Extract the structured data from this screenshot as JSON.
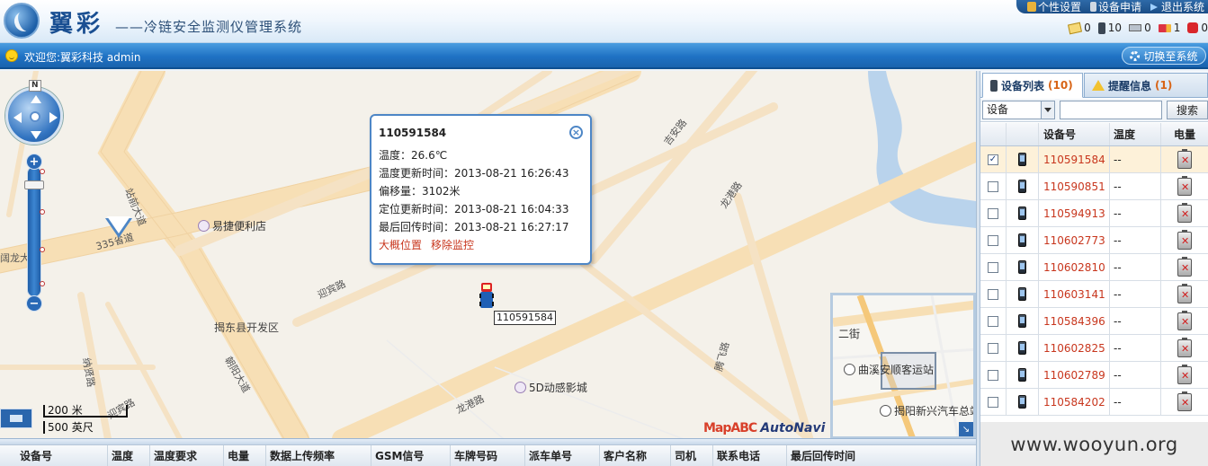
{
  "header": {
    "brand": "翼彩",
    "system_title": "——冷链安全监测仪管理系统",
    "top_links": [
      {
        "label": "个性设置",
        "icon": "user-settings-icon"
      },
      {
        "label": "设备申请",
        "icon": "device-apply-icon"
      },
      {
        "label": "退出系统",
        "icon": "logout-arrow-icon"
      }
    ],
    "counters": [
      {
        "value": "0",
        "icon": "message-envelope-icon"
      },
      {
        "value": "10",
        "icon": "device-phone-icon"
      },
      {
        "value": "0",
        "icon": "device-offline-icon"
      },
      {
        "value": "1",
        "icon": "truck-icon"
      },
      {
        "value": "0",
        "icon": "alarm-bell-icon"
      }
    ]
  },
  "welcome": {
    "text": "欢迎您:翼彩科技 admin",
    "switch_label": "切换至系统"
  },
  "map": {
    "compass_label": "N",
    "road_labels": {
      "zhanqian": "站前大道",
      "shengdao": "335省道",
      "yingbin1": "迎宾路",
      "yingbin2": "迎宾路",
      "jian": "吉安路",
      "longgang1": "龙港路",
      "longgang2": "龙港路",
      "chaoyang": "朝阳大道",
      "naxian": "纳贤路",
      "longda": "阔龙大",
      "tengfei": "腾飞路",
      "kaifaqu": "揭东县开发区"
    },
    "pois": {
      "store": "易捷便利店",
      "cinema": "5D动感影城"
    },
    "vehicle_label": "110591584",
    "scale_metric": "200 米",
    "scale_imperial": "500 英尺",
    "attribution_mapabc": "MapABC",
    "attribution_autonavi": "AutoNavi",
    "overview": {
      "label_erjie": "二街",
      "label_station1": "曲溪安顺客运站",
      "label_station2": "揭阳新兴汽车总站"
    }
  },
  "popup": {
    "title": "110591584",
    "lines": [
      "温度：26.6℃",
      "温度更新时间：2013-08-21 16:26:43",
      "偏移量：3102米",
      "定位更新时间：2013-08-21 16:04:33",
      "最后回传时间：2013-08-21 16:27:17"
    ],
    "link_approx": "大概位置",
    "link_remove": "移除监控",
    "close_symbol": "×"
  },
  "bottom_table": {
    "columns": [
      "设备号",
      "温度",
      "温度要求",
      "电量",
      "数据上传频率",
      "GSM信号",
      "车牌号码",
      "派车单号",
      "客户名称",
      "司机",
      "联系电话",
      "最后回传时间"
    ]
  },
  "side": {
    "tabs": {
      "devices_label": "设备列表",
      "devices_count": "(10)",
      "alerts_label": "提醒信息",
      "alerts_count": "(1)"
    },
    "search": {
      "type_value": "设备",
      "input_value": "",
      "button_label": "搜索"
    },
    "table": {
      "headers": [
        "设备号",
        "温度",
        "电量"
      ],
      "rows": [
        {
          "id": "110591584",
          "temp": "--",
          "checked": true
        },
        {
          "id": "110590851",
          "temp": "--",
          "checked": false
        },
        {
          "id": "110594913",
          "temp": "--",
          "checked": false
        },
        {
          "id": "110602773",
          "temp": "--",
          "checked": false
        },
        {
          "id": "110602810",
          "temp": "--",
          "checked": false
        },
        {
          "id": "110603141",
          "temp": "--",
          "checked": false
        },
        {
          "id": "110584396",
          "temp": "--",
          "checked": false
        },
        {
          "id": "110602825",
          "temp": "--",
          "checked": false
        },
        {
          "id": "110602789",
          "temp": "--",
          "checked": false
        },
        {
          "id": "110584202",
          "temp": "--",
          "checked": false
        }
      ]
    }
  },
  "watermark": "www.wooyun.org"
}
